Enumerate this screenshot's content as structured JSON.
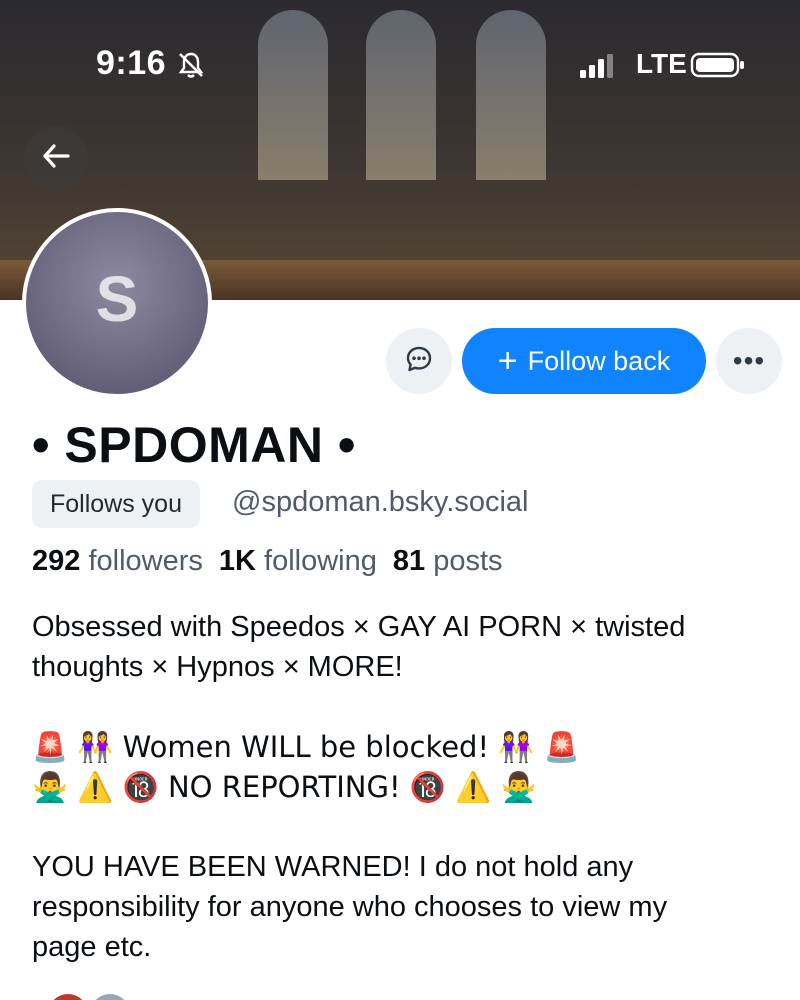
{
  "status_bar": {
    "time": "9:16",
    "network": "LTE",
    "icons": [
      "bell-slash-icon",
      "signal-icon",
      "battery-icon"
    ]
  },
  "banner": {
    "placeholder_note": ""
  },
  "header": {
    "back_icon": "arrow-left-icon"
  },
  "profile": {
    "avatar_initial": "S",
    "display_name": "• SPDOMAN •",
    "follows_you_label": "Follows you",
    "handle": "@spdoman.bsky.social",
    "stats": {
      "followers_count": "292",
      "followers_label": "followers",
      "following_count": "1K",
      "following_label": "following",
      "posts_count": "81",
      "posts_label": "posts"
    },
    "bio": {
      "line1": "Obsessed with Speedos × GAY AI PORN × twisted",
      "line2": "thoughts × Hypnos × MORE!",
      "line3": "🚨 👭 Women WILL be blocked! 👭 🚨",
      "line4": "🙅‍♂️ ⚠️ 🔞 NO REPORTING! 🔞 ⚠️ 🙅‍♂️",
      "line5": "YOU HAVE BEEN WARNED! I do not hold any",
      "line6": "responsibility for anyone who chooses to view my",
      "line7": "page etc."
    }
  },
  "actions": {
    "message_icon": "chat-bubble-icon",
    "follow_back_label": "Follow back",
    "follow_plus": "+",
    "more_label": "•••"
  },
  "colors": {
    "accent": "#1083fe",
    "secondary_text": "#4f5b6a",
    "chip_bg": "#eef1f4"
  }
}
